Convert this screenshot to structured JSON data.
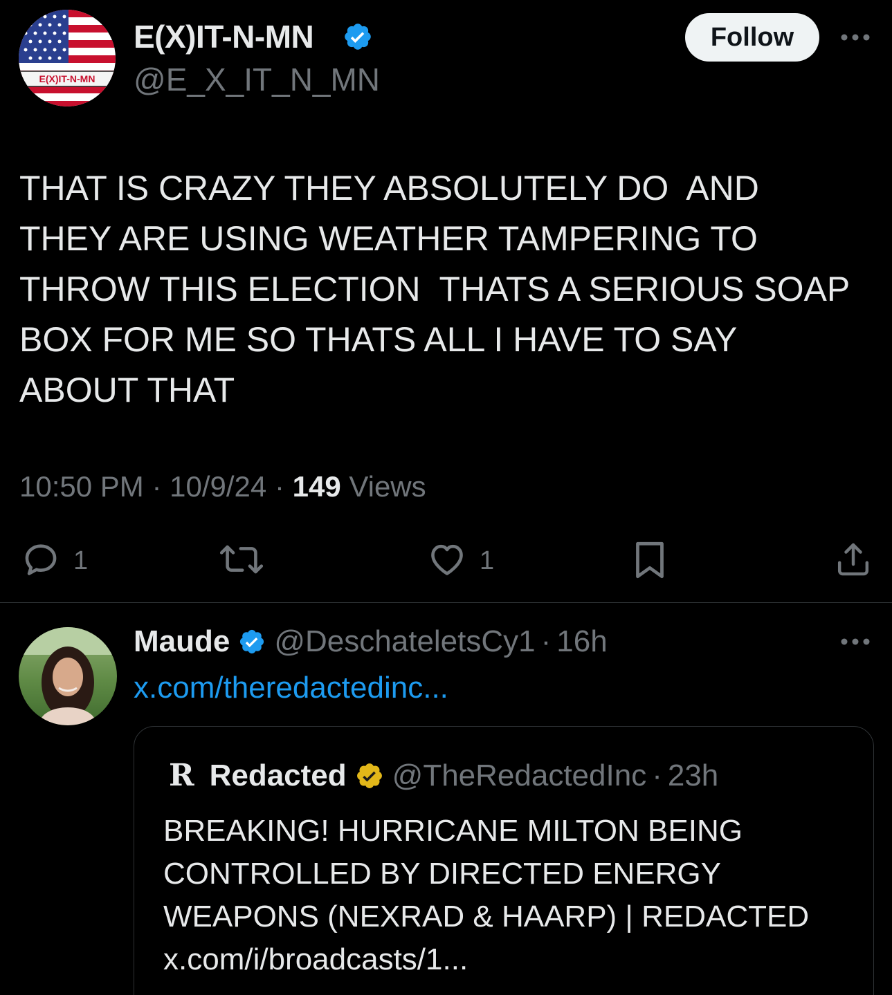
{
  "tweet": {
    "author": {
      "name": "E(X)IT-N-MN",
      "handle": "@E_X_IT_N_MN",
      "avatar_badge": "E(X)IT-N-MN"
    },
    "follow_label": "Follow",
    "text": "THAT IS CRAZY THEY ABSOLUTELY DO  AND\nTHEY ARE USING WEATHER TAMPERING TO\nTHROW THIS ELECTION  THATS A SERIOUS SOAP\nBOX FOR ME SO THATS ALL I HAVE TO SAY\nABOUT THAT",
    "time": "10:50 PM",
    "date": "10/9/24",
    "views_count": "149",
    "views_label": "Views",
    "sep": "·",
    "actions": {
      "reply_count": "1",
      "like_count": "1"
    }
  },
  "reply": {
    "name": "Maude",
    "handle": "@DeschateletsCy1",
    "sep": "·",
    "age": "16h",
    "link_text": "x.com/theredactedinc...",
    "quote": {
      "logo": "R",
      "name": "Redacted",
      "handle": "@TheRedactedInc",
      "sep": "·",
      "age": "23h",
      "text": "BREAKING! HURRICANE MILTON BEING\nCONTROLLED BY DIRECTED ENERGY\nWEAPONS (NEXRAD & HAARP) | REDACTED\nx.com/i/broadcasts/1..."
    }
  },
  "colors": {
    "background": "#000000",
    "text": "#e7e9ea",
    "muted": "#71767b",
    "link": "#1d9bf0",
    "verified_blue": "#1d9bf0",
    "verified_gold": "#e2b719",
    "divider": "#2f3336"
  },
  "icons": {
    "verified": "verified-badge-icon",
    "more": "more-horizontal-icon",
    "reply": "reply-icon",
    "retweet": "retweet-icon",
    "like": "heart-icon",
    "bookmark": "bookmark-icon",
    "share": "share-icon"
  }
}
